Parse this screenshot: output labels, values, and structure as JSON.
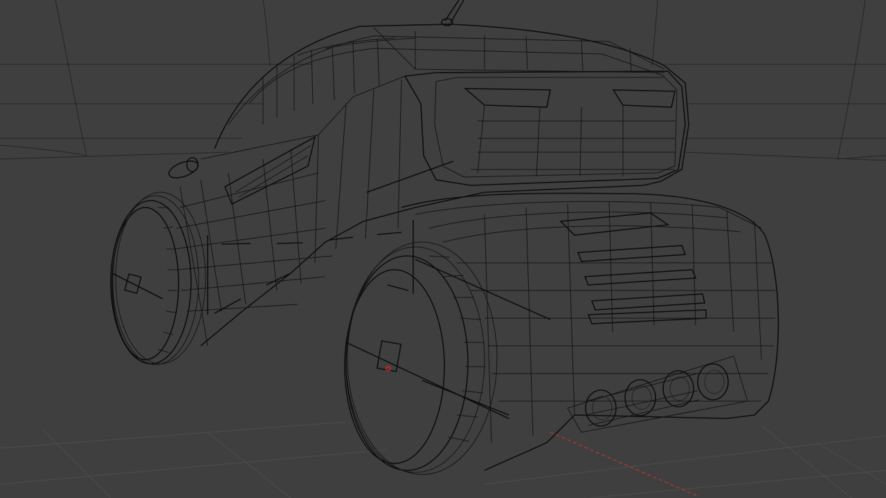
{
  "viewport": {
    "mode": "wireframe",
    "background": "#3f3f3f",
    "wire_color": "#141414",
    "floor_grid_color": "#4d4d4d",
    "x_axis_color": "#c0392b",
    "selected_vertex_color": "#e02020"
  }
}
